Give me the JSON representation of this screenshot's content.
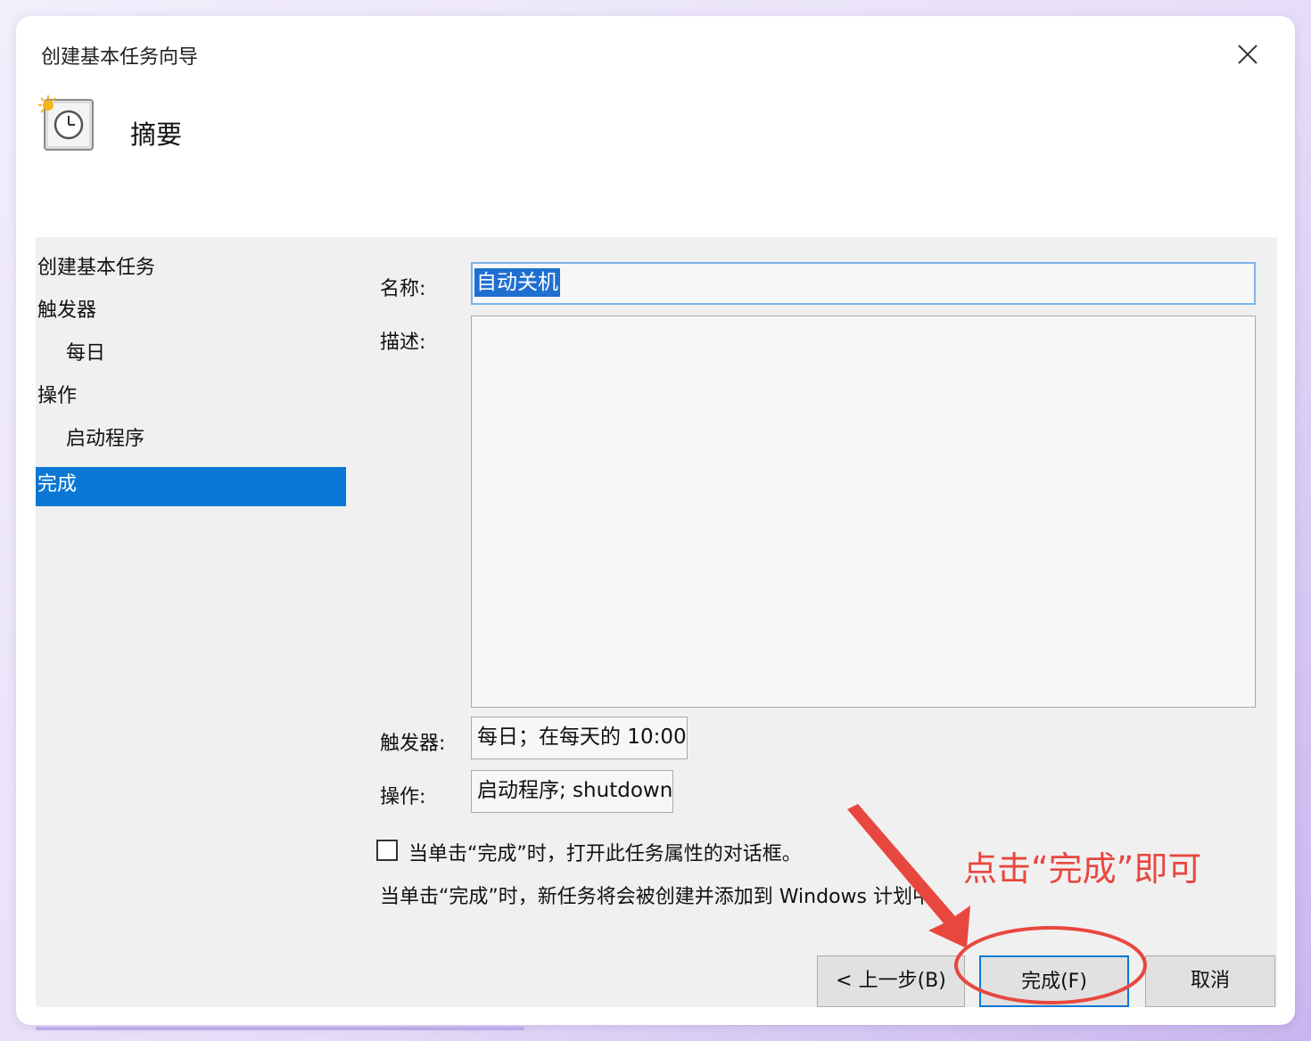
{
  "window": {
    "title": "创建基本任务向导",
    "heading": "摘要",
    "close_icon": "close-icon",
    "wizard_icon": "scheduled-task-clock-icon"
  },
  "sidebar": {
    "items": [
      {
        "label": "创建基本任务"
      },
      {
        "label": "触发器"
      },
      {
        "label": "每日"
      },
      {
        "label": "操作"
      },
      {
        "label": "启动程序"
      },
      {
        "label": "完成",
        "active": true
      }
    ]
  },
  "form": {
    "name_label": "名称:",
    "name_value": "自动关机",
    "description_label": "描述:",
    "description_value": "",
    "trigger_label": "触发器:",
    "trigger_value": "每日；在每天的 10:00",
    "action_label": "操作:",
    "action_value": "启动程序; shutdown"
  },
  "options": {
    "open_properties_label": "当单击“完成”时，打开此任务属性的对话框。",
    "open_properties_checked": false,
    "info_text": "当单击“完成”时，新任务将会被创建并添加到 Windows 计划中。"
  },
  "buttons": {
    "back": "< 上一步(B)",
    "finish": "完成(F)",
    "cancel": "取消"
  },
  "annotation": {
    "text": "点击“完成”即可",
    "color": "#e8473f"
  },
  "colors": {
    "selection": "#0a77d4",
    "annotation": "#e8473f"
  }
}
